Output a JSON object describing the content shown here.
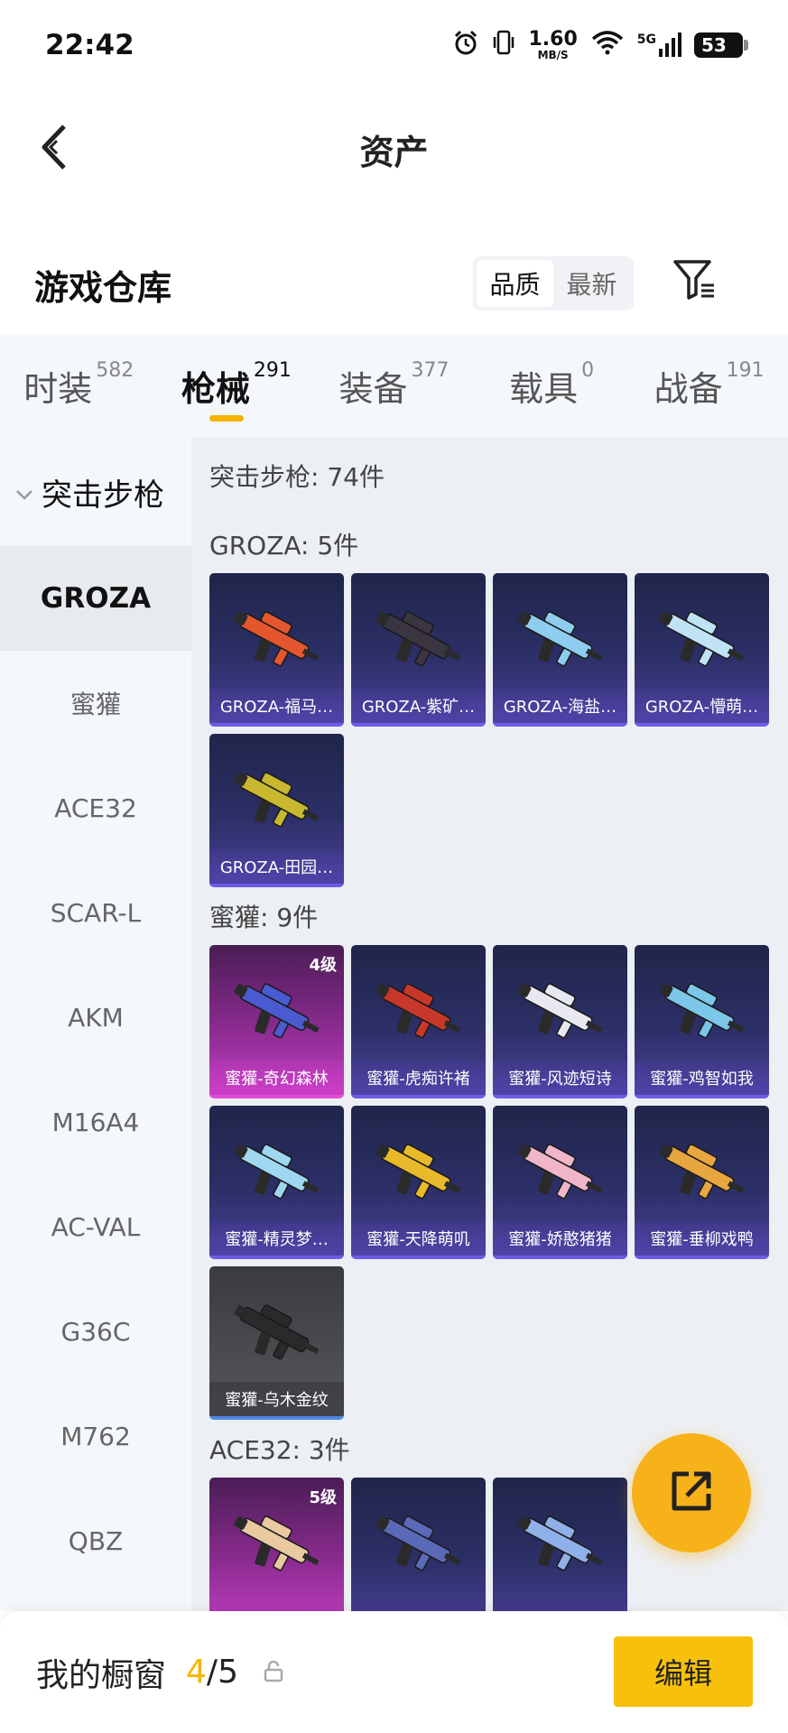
{
  "status_bar": {
    "time": "22:42",
    "speed_value": "1.60",
    "speed_unit": "MB/S",
    "network": "5G",
    "battery": "53",
    "icons": [
      "alarm-icon",
      "vibrate-icon",
      "wifi-icon",
      "signal-icon",
      "battery-icon"
    ]
  },
  "header": {
    "title": "资产",
    "back_icon": "chevron-left-icon"
  },
  "warehouse": {
    "title": "游戏仓库",
    "sort_options": [
      "品质",
      "最新"
    ],
    "sort_selected": "品质",
    "filter_icon": "filter-icon"
  },
  "tabs": [
    {
      "label": "时装",
      "count": "582"
    },
    {
      "label": "枪械",
      "count": "291",
      "active": true
    },
    {
      "label": "装备",
      "count": "377"
    },
    {
      "label": "载具",
      "count": "0"
    },
    {
      "label": "战备",
      "count": "191"
    }
  ],
  "sidebar": {
    "group_label": "突击步枪",
    "items": [
      "GROZA",
      "蜜獾",
      "ACE32",
      "SCAR-L",
      "AKM",
      "M16A4",
      "AC-VAL",
      "G36C",
      "M762",
      "QBZ"
    ],
    "active_item": "GROZA"
  },
  "main": {
    "category_heading": "突击步枪: 74件",
    "groups": [
      {
        "heading": "GROZA: 5件",
        "items": [
          {
            "name": "GROZA-福马…",
            "tier": "purple",
            "gun_color": "#e4572e"
          },
          {
            "name": "GROZA-紫矿…",
            "tier": "purple",
            "gun_color": "#3a3540"
          },
          {
            "name": "GROZA-海盐…",
            "tier": "purple",
            "gun_color": "#8ecdf0"
          },
          {
            "name": "GROZA-懵萌…",
            "tier": "purple",
            "gun_color": "#bfe3f5"
          },
          {
            "name": "GROZA-田园…",
            "tier": "purple",
            "gun_color": "#c8b830"
          }
        ]
      },
      {
        "heading": "蜜獾: 9件",
        "items": [
          {
            "name": "蜜獾-奇幻森林",
            "tier": "pink",
            "level": "4级",
            "gun_color": "#4a5ad0"
          },
          {
            "name": "蜜獾-虎痴许褚",
            "tier": "purple",
            "gun_color": "#c8382a"
          },
          {
            "name": "蜜獾-风迹短诗",
            "tier": "purple",
            "gun_color": "#e8e8f0"
          },
          {
            "name": "蜜獾-鸡智如我",
            "tier": "purple",
            "gun_color": "#7cc6e8"
          },
          {
            "name": "蜜獾-精灵梦…",
            "tier": "purple",
            "gun_color": "#9fd6f0"
          },
          {
            "name": "蜜獾-天降萌叽",
            "tier": "purple",
            "gun_color": "#e8b92a"
          },
          {
            "name": "蜜獾-娇憨猪猪",
            "tier": "purple",
            "gun_color": "#f0b6c8"
          },
          {
            "name": "蜜獾-垂柳戏鸭",
            "tier": "purple",
            "gun_color": "#e8a640"
          },
          {
            "name": "蜜獾-乌木金纹",
            "tier": "grey",
            "gun_color": "#2a2a2a"
          }
        ]
      },
      {
        "heading": "ACE32: 3件",
        "items": [
          {
            "name": "",
            "tier": "pink",
            "level": "5级",
            "gun_color": "#e8c9a0"
          },
          {
            "name": "",
            "tier": "purple",
            "gun_color": "#5a6ab8"
          },
          {
            "name": "",
            "tier": "purple",
            "gun_color": "#8fb0e8"
          }
        ]
      }
    ]
  },
  "fab": {
    "icon": "share-export-icon"
  },
  "bottom_bar": {
    "label": "我的橱窗",
    "current": "4",
    "separator": "/",
    "total": "5",
    "lock_icon": "lock-icon",
    "edit_label": "编辑"
  },
  "colors": {
    "accent": "#f5b400",
    "button": "#f7c00a",
    "sidebar_bg": "#f4f7fb",
    "grid_bg": "#eceff3"
  }
}
